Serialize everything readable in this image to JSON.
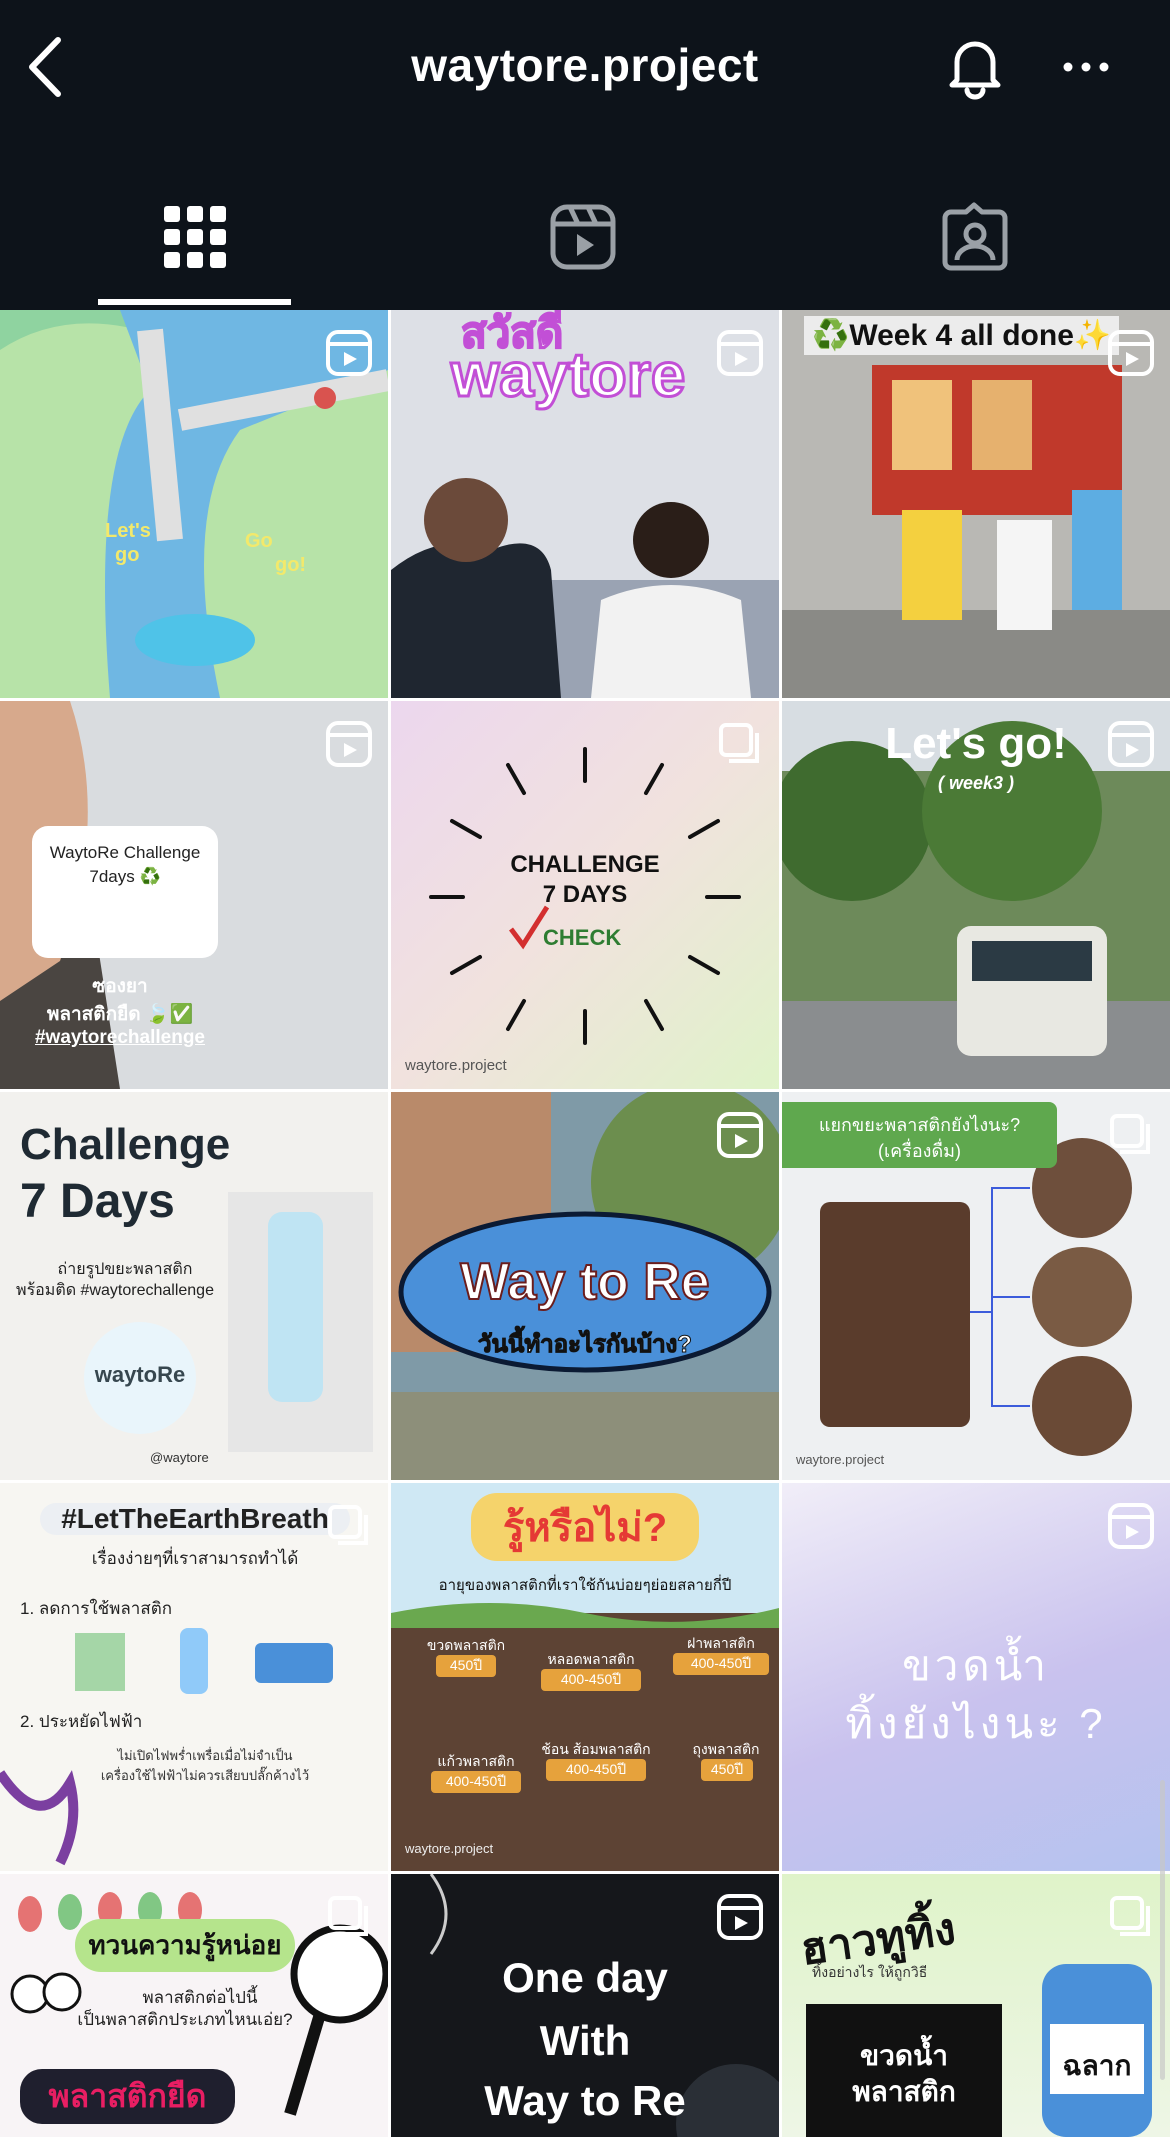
{
  "header": {
    "title": "waytore.project"
  },
  "tabs": [
    {
      "name": "posts",
      "icon": "grid-icon",
      "active": true
    },
    {
      "name": "reels",
      "icon": "reels-icon",
      "active": false
    },
    {
      "name": "tagged",
      "icon": "tagged-icon",
      "active": false
    }
  ],
  "posts": [
    {
      "type": "reel",
      "texts": [
        "Let's",
        "go",
        "Go",
        "go!"
      ]
    },
    {
      "type": "reel",
      "texts": [
        "สวัสดี",
        "waytore"
      ]
    },
    {
      "type": "reel",
      "texts": [
        "♻️Week 4 all done✨"
      ]
    },
    {
      "type": "reel",
      "texts": [
        "WaytoRe Challenge",
        "7days ♻️",
        "ซองยา",
        "พลาสติกยืด 🍃✅",
        "#waytorechallenge"
      ]
    },
    {
      "type": "carousel",
      "texts": [
        "CHALLENGE",
        "7 DAYS",
        "CHECK",
        "waytore.project"
      ]
    },
    {
      "type": "reel",
      "texts": [
        "Let's go!",
        "( week3 )"
      ]
    },
    {
      "type": "image",
      "texts": [
        "Challenge",
        "7 Days",
        "ถ่ายรูปขยะพลาสติก",
        "พร้อมติด #waytorechallenge",
        "waytoRe",
        "@waytore"
      ]
    },
    {
      "type": "reel",
      "texts": [
        "Way to Re",
        "วันนี้ทำอะไรกันบ้าง?"
      ]
    },
    {
      "type": "carousel",
      "texts": [
        "แยกขยะพลาสติกยังไงนะ?",
        "(เครื่องดื่ม)",
        "waytore.project"
      ]
    },
    {
      "type": "carousel",
      "texts": [
        "#LetTheEarthBreath",
        "เรื่องง่ายๆที่เราสามารถทำได้",
        "1. ลดการใช้พลาสติก",
        "2. ประหยัดไฟฟ้า",
        "ไม่เปิดไฟพร่ำเพรื่อเมื่อไม่จำเป็น",
        "เครื่องใช้ไฟฟ้าไม่ควรเสียบปลั๊กค้างไว้"
      ]
    },
    {
      "type": "image",
      "texts": [
        "รู้หรือไม่?",
        "อายุของพลาสติกที่เราใช้กันบ่อยๆย่อยสลายกี่ปี",
        "ขวดพลาสติก",
        "450ปี",
        "หลอดพลาสติก",
        "400-450ปี",
        "ฝาพลาสติก",
        "400-450ปี",
        "แก้วพลาสติก",
        "400-450ปี",
        "ช้อน ส้อมพลาสติก",
        "400-450ปี",
        "ถุงพลาสติก",
        "450ปี",
        "waytore.project"
      ]
    },
    {
      "type": "reel",
      "texts": [
        "ขวดน้ำ",
        "ทิ้งยังไงนะ ?"
      ]
    },
    {
      "type": "carousel",
      "texts": [
        "ทวนความรู้หน่อย",
        "พลาสติกต่อไปนี้",
        "เป็นพลาสติกประเภทไหนเอ่ย?",
        "พลาสติกยืด"
      ]
    },
    {
      "type": "reel",
      "texts": [
        "One day",
        "With",
        "Way to Re"
      ]
    },
    {
      "type": "carousel",
      "texts": [
        "ฮาวทูทิ้ง",
        "ทิ้งอย่างไร ให้ถูกวิธี",
        "ขวดน้ำ",
        "พลาสติก",
        "ฉลาก"
      ]
    }
  ]
}
